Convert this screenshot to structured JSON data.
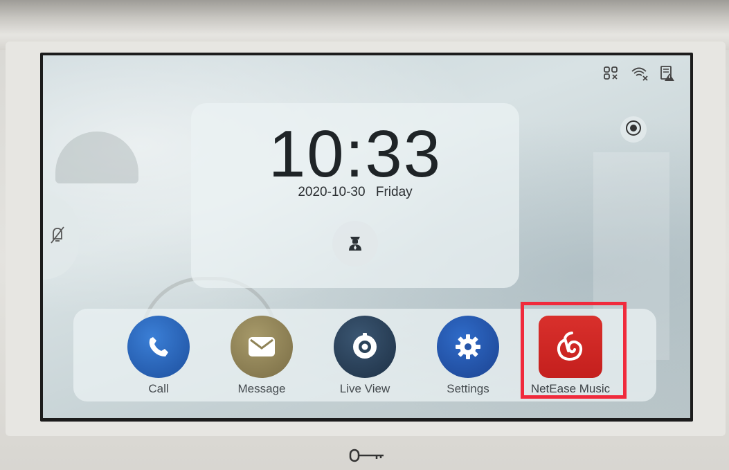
{
  "status_bar": {
    "icons": [
      "network-disconnected-icon",
      "wifi-off-icon",
      "sd-card-warning-icon"
    ]
  },
  "clock": {
    "time": "10:33",
    "date": "2020-10-30",
    "weekday": "Friday"
  },
  "dock": {
    "apps": [
      {
        "label": "Call",
        "icon": "phone-icon",
        "color": "#2a63b8"
      },
      {
        "label": "Message",
        "icon": "envelope-icon",
        "color": "#8f8357"
      },
      {
        "label": "Live View",
        "icon": "camera-icon",
        "color": "#2b4359"
      },
      {
        "label": "Settings",
        "icon": "gear-icon",
        "color": "#2555a8"
      },
      {
        "label": "NetEase Music",
        "icon": "netease-music-icon",
        "color": "#cf2825"
      }
    ]
  },
  "highlight_color": "#f02a3c",
  "side_tab_icon": "do-not-disturb-bell-icon",
  "guard_icon": "security-guard-icon",
  "record_icon": "record-icon",
  "hardware_key_icon": "unlock-key-icon"
}
